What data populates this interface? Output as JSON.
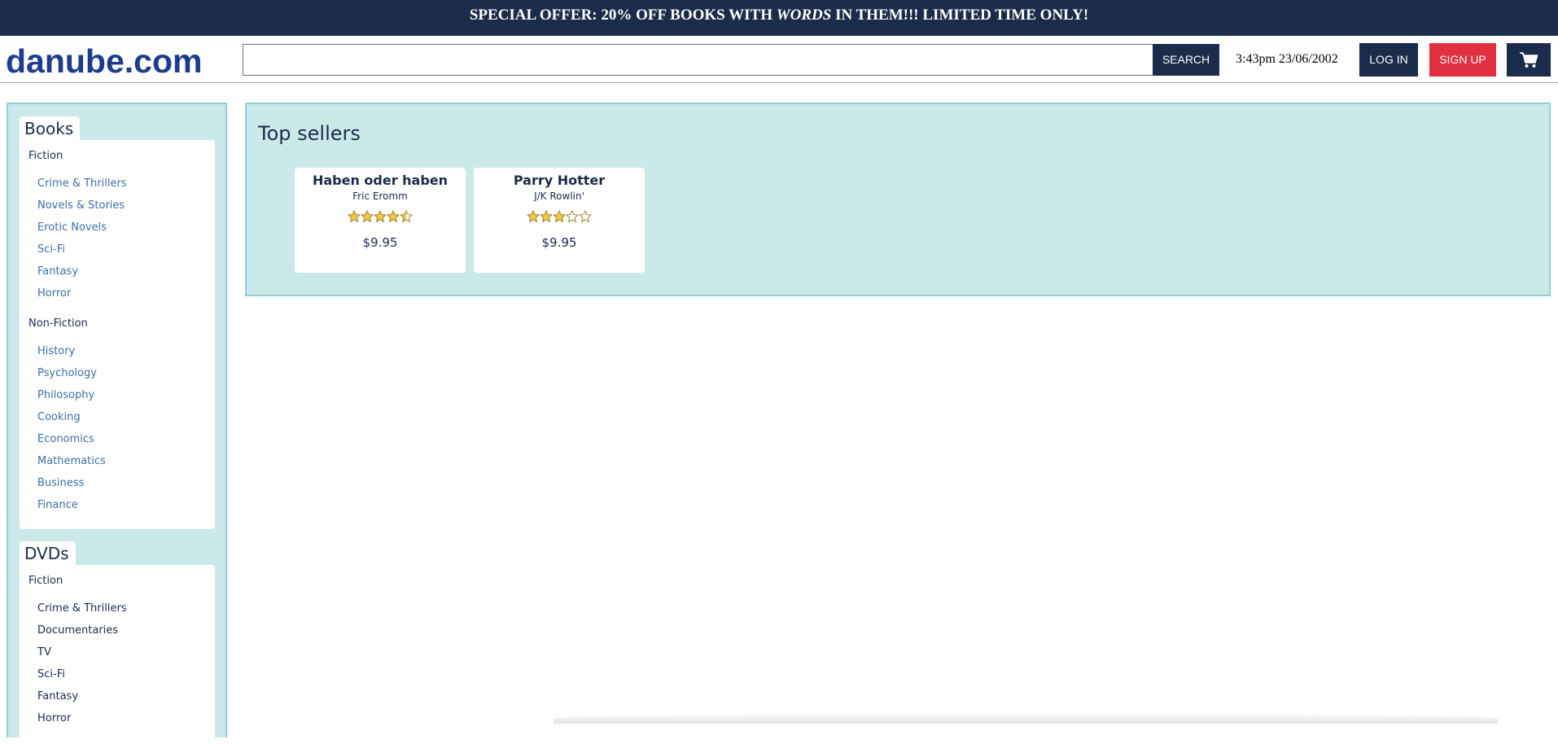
{
  "banner": {
    "text_before": "SPECIAL OFFER: 20% OFF BOOKS WITH ",
    "text_em": "WORDS",
    "text_after": " IN THEM!!! LIMITED TIME ONLY!"
  },
  "header": {
    "logo": "danube.com",
    "search_value": "",
    "search_placeholder": "",
    "search_label": "SEARCH",
    "datetime": "3:43pm 23/06/2002",
    "login_label": "LOG IN",
    "signup_label": "SIGN UP",
    "cart_icon": "shopping-cart-icon"
  },
  "sidebar": {
    "books": {
      "title": "Books",
      "fiction_label": "Fiction",
      "fiction": [
        "Crime & Thrillers",
        "Novels & Stories",
        "Erotic Novels",
        "Sci-Fi",
        "Fantasy",
        "Horror"
      ],
      "nonfiction_label": "Non-Fiction",
      "nonfiction": [
        "History",
        "Psychology",
        "Philosophy",
        "Cooking",
        "Economics",
        "Mathematics",
        "Business",
        "Finance"
      ]
    },
    "dvds": {
      "title": "DVDs",
      "fiction_label": "Fiction",
      "fiction": [
        "Crime & Thrillers",
        "Documentaries",
        "TV",
        "Sci-Fi",
        "Fantasy",
        "Horror"
      ]
    }
  },
  "main": {
    "title": "Top sellers",
    "products": [
      {
        "title": "Haben oder haben",
        "author": "Fric Eromm",
        "rating": 4.5,
        "rating_max": 5,
        "price": "$9.95"
      },
      {
        "title": "Parry Hotter",
        "author": "J/K Rowlin'",
        "rating": 3,
        "rating_max": 5,
        "price": "$9.95"
      }
    ]
  },
  "colors": {
    "navy": "#1b2b4b",
    "red": "#e0303f",
    "panel": "#cce9ea",
    "panel_border": "#8fd0d2",
    "link": "#3c6fa8",
    "logo": "#1d3c8f",
    "star_fill": "#f2c94c"
  }
}
